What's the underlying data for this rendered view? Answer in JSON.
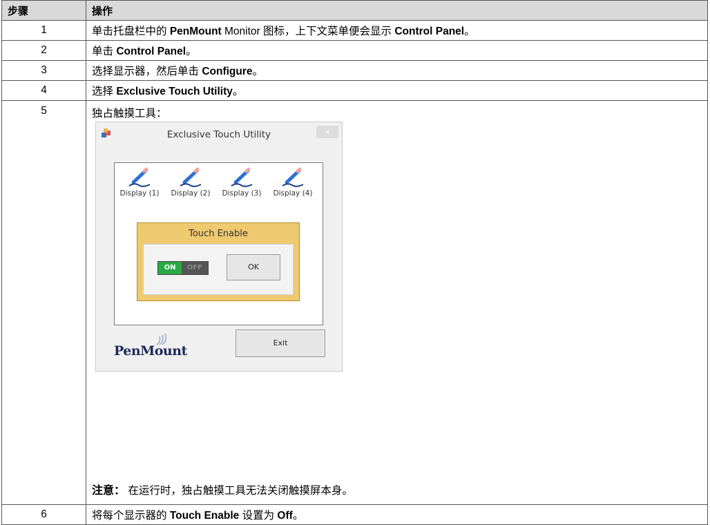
{
  "header": {
    "col_step": "步骤",
    "col_action": "操作"
  },
  "rows": [
    {
      "step": "1",
      "pre": "单击托盘栏中的 ",
      "b1": "PenMount",
      "mid": " Monitor 图标，上下文菜单便会显示 ",
      "b2": "Control Panel",
      "post": "。"
    },
    {
      "step": "2",
      "pre": "单击 ",
      "b1": "Control Panel",
      "post": "。"
    },
    {
      "step": "3",
      "pre": "选择显示器，然后单击 ",
      "b1": "Configure",
      "post": "。"
    },
    {
      "step": "4",
      "pre": "选择 ",
      "b1": "Exclusive Touch Utility",
      "post": "。"
    },
    {
      "step": "5",
      "title": "独占触摸工具：",
      "note_label": "注意：",
      "note_text": " 在运行时，独占触摸工具无法关闭触摸屏本身。"
    },
    {
      "step": "6",
      "pre": "将每个显示器的 ",
      "b1": "Touch Enable",
      "mid": " 设置为 ",
      "b2": "Off",
      "post": "。"
    }
  ],
  "dialog": {
    "title": "Exclusive Touch Utility",
    "close": "×",
    "displays": [
      "Display (1)",
      "Display (2)",
      "Display (3)",
      "Display (4)"
    ],
    "touch_enable_label": "Touch Enable",
    "toggle_on": "ON",
    "toggle_off": "OFF",
    "toggle_state": "on",
    "ok_label": "OK",
    "exit_label": "Exit",
    "logo_text": "PenMount",
    "colors": {
      "touch_box": "#eec96f",
      "toggle_on": "#2aa845",
      "logo": "#1d2a5a"
    }
  }
}
